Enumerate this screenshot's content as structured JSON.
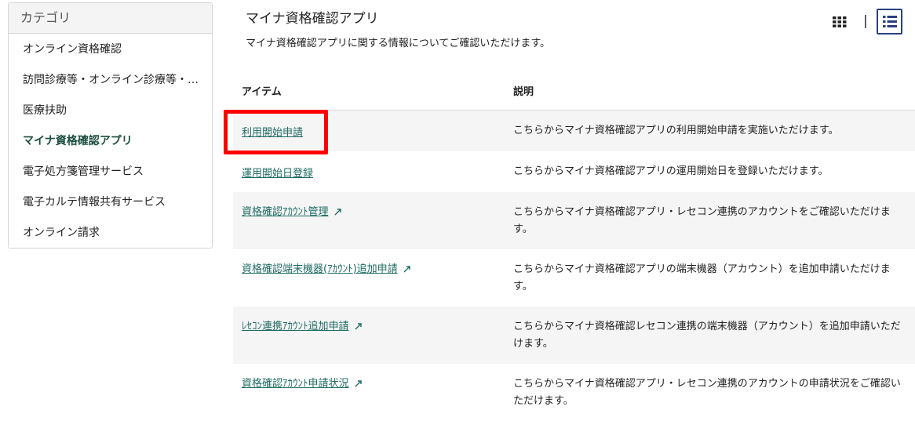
{
  "sidebar": {
    "header": "カテゴリ",
    "items": [
      {
        "label": "オンライン資格確認"
      },
      {
        "label": "訪問診療等・オンライン診療等・オンライン服薬指導"
      },
      {
        "label": "医療扶助"
      },
      {
        "label": "マイナ資格確認アプリ"
      },
      {
        "label": "電子処方箋管理サービス"
      },
      {
        "label": "電子カルテ情報共有サービス"
      },
      {
        "label": "オンライン請求"
      }
    ],
    "active_index": 3
  },
  "main": {
    "title": "マイナ資格確認アプリ",
    "description": "マイナ資格確認アプリに関する情報についてご確認いただけます。",
    "view_separator": "|"
  },
  "table": {
    "headers": {
      "item": "アイテム",
      "description": "説明"
    },
    "rows": [
      {
        "item": "利用開始申請",
        "external": false,
        "description": "こちらからマイナ資格確認アプリの利用開始申請を実施いただけます。"
      },
      {
        "item": "運用開始日登録",
        "external": false,
        "description": "こちらからマイナ資格確認アプリの運用開始日を登録いただけます。"
      },
      {
        "item": "資格確認ｱｶｳﾝﾄ管理",
        "external": true,
        "description": "こちらからマイナ資格確認アプリ・レセコン連携のアカウントをご確認いただけます。"
      },
      {
        "item": "資格確認端末機器(ｱｶｳﾝﾄ)追加申請",
        "external": true,
        "description": "こちらからマイナ資格確認アプリの端末機器（アカウント）を追加申請いただけます。"
      },
      {
        "item": "ﾚｾｺﾝ連携ｱｶｳﾝﾄ追加申請",
        "external": true,
        "description": "こちらからマイナ資格確認レセコン連携の端末機器（アカウント）を追加申請いただけます。"
      },
      {
        "item": "資格確認ｱｶｳﾝﾄ申請状況",
        "external": true,
        "description": "こちらからマイナ資格確認アプリ・レセコン連携のアカウントの申請状況をご確認いただけます。"
      }
    ]
  },
  "colors": {
    "link": "#1f6b63",
    "active_sidebar": "#1b4d3e",
    "highlight": "#ff0000",
    "toggle_border": "#2a3f83"
  },
  "icons": {
    "grid_view": "grid-icon",
    "list_view": "list-icon",
    "external_link": "external-link-icon"
  }
}
